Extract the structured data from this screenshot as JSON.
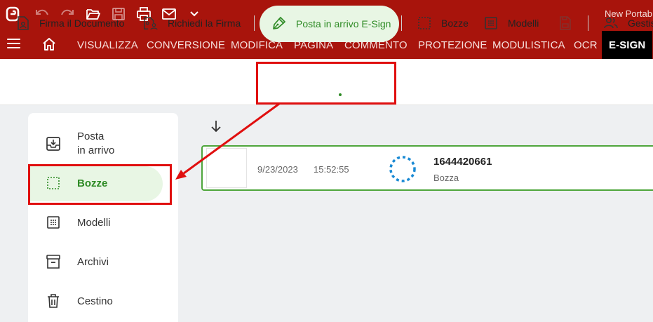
{
  "app": {
    "title": "New Portab"
  },
  "quick_access": {
    "icons": [
      "app-logo-icon",
      "undo-icon",
      "redo-icon",
      "open-folder-icon",
      "save-icon",
      "print-icon",
      "email-icon",
      "chevron-down-icon"
    ]
  },
  "ribbon": {
    "tabs": [
      {
        "label": "VISUALIZZA"
      },
      {
        "label": "CONVERSIONE"
      },
      {
        "label": "MODIFICA"
      },
      {
        "label": "PAGINA"
      },
      {
        "label": "COMMENTO"
      },
      {
        "label": "PROTEZIONE"
      },
      {
        "label": "MODULISTICA"
      },
      {
        "label": "OCR"
      },
      {
        "label": "E-SIGN",
        "active": true
      }
    ]
  },
  "toolbar": {
    "sign_document": "Firma il Documento",
    "request_signature": "Richiedi la Firma",
    "esign_inbox": "Posta in arrivo E-Sign",
    "drafts": "Bozze",
    "templates": "Modelli",
    "manage": "Gestis"
  },
  "sidebar": {
    "items": [
      {
        "label_line1": "Posta",
        "label_line2": "in arrivo",
        "icon": "inbox-icon"
      },
      {
        "label": "Bozze",
        "icon": "drafts-icon",
        "active": true
      },
      {
        "label": "Modelli",
        "icon": "templates-icon"
      },
      {
        "label": "Archivi",
        "icon": "archive-icon"
      },
      {
        "label": "Cestino",
        "icon": "trash-icon"
      }
    ]
  },
  "documents": [
    {
      "date": "9/23/2023",
      "time": "15:52:55",
      "id": "1644420661",
      "status": "Bozza"
    }
  ],
  "colors": {
    "brand_red": "#a8140c",
    "active_green": "#2e8b25",
    "active_bg": "#e8f6e4",
    "callout_red": "#e00f0f",
    "spinner_blue": "#1a8ad4"
  }
}
